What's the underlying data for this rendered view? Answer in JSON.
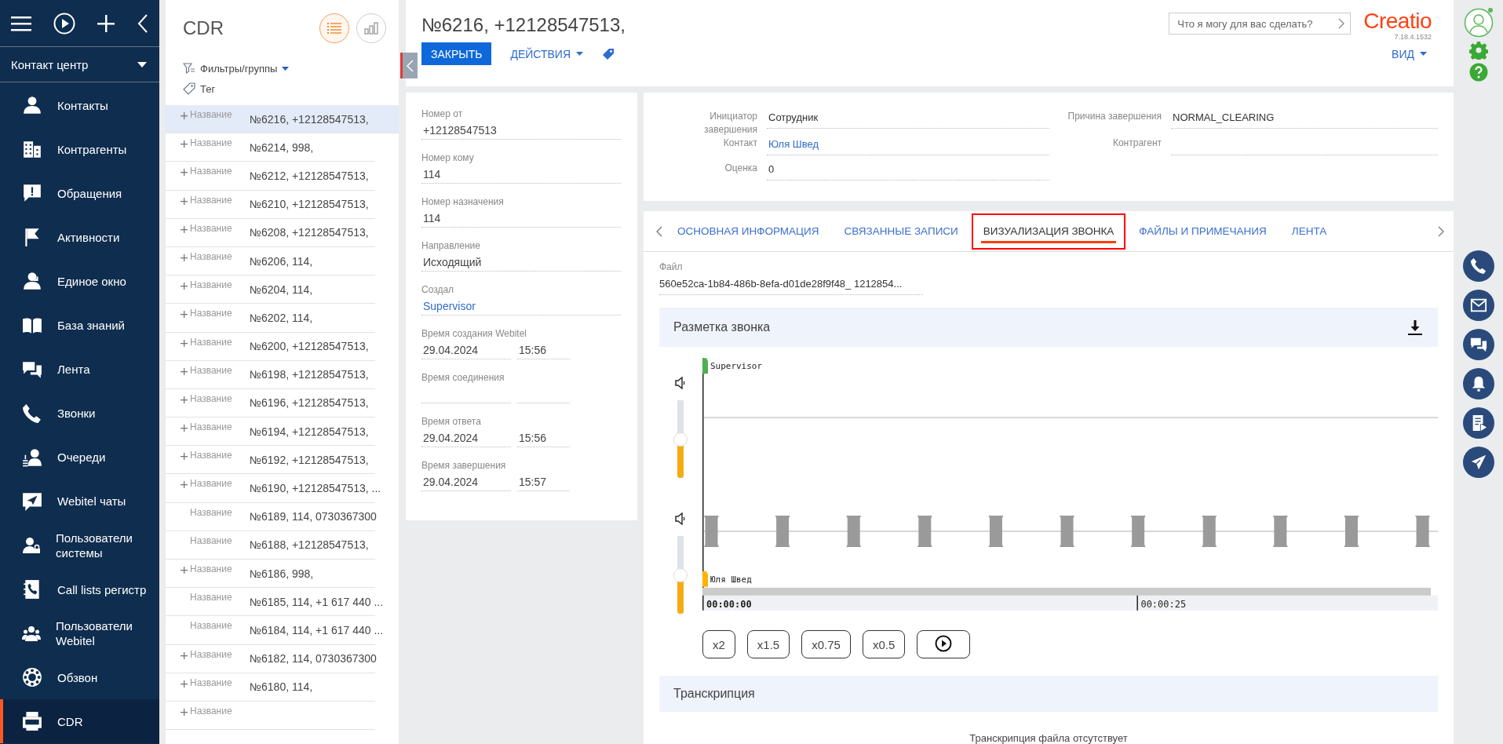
{
  "sidebar": {
    "workplace": "Контакт центр",
    "items": [
      {
        "label": "Контакты",
        "selected": false
      },
      {
        "label": "Контрагенты",
        "selected": false
      },
      {
        "label": "Обращения",
        "selected": false
      },
      {
        "label": "Активности",
        "selected": false
      },
      {
        "label": "Единое окно",
        "selected": false
      },
      {
        "label": "База знаний",
        "selected": false
      },
      {
        "label": "Лента",
        "selected": false
      },
      {
        "label": "Звонки",
        "selected": false
      },
      {
        "label": "Очереди",
        "selected": false
      },
      {
        "label": "Webitel чаты",
        "selected": false
      },
      {
        "label": "Пользователи системы",
        "selected": false
      },
      {
        "label": "Call lists регистр",
        "selected": false
      },
      {
        "label": "Пользователи Webitel",
        "selected": false
      },
      {
        "label": "Обзвон",
        "selected": false
      },
      {
        "label": "CDR",
        "selected": true
      }
    ]
  },
  "list": {
    "title": "CDR",
    "view_buttons": [
      {
        "selected": true
      },
      {
        "selected": false
      }
    ],
    "filters": "Фильтры/группы",
    "tag": "Тег",
    "rows": [
      {
        "label": "Название",
        "value": "№6216, +12128547513,",
        "plus": true,
        "selected": true
      },
      {
        "label": "Название",
        "value": "№6214, 998,",
        "plus": true,
        "selected": false
      },
      {
        "label": "Название",
        "value": "№6212, +12128547513,",
        "plus": true,
        "selected": false
      },
      {
        "label": "Название",
        "value": "№6210, +12128547513,",
        "plus": true,
        "selected": false
      },
      {
        "label": "Название",
        "value": "№6208, +12128547513,",
        "plus": true,
        "selected": false
      },
      {
        "label": "Название",
        "value": "№6206, 114,",
        "plus": true,
        "selected": false
      },
      {
        "label": "Название",
        "value": "№6204, 114,",
        "plus": true,
        "selected": false
      },
      {
        "label": "Название",
        "value": "№6202, 114,",
        "plus": true,
        "selected": false
      },
      {
        "label": "Название",
        "value": "№6200, +12128547513,",
        "plus": true,
        "selected": false
      },
      {
        "label": "Название",
        "value": "№6198, +12128547513,",
        "plus": true,
        "selected": false
      },
      {
        "label": "Название",
        "value": "№6196, +12128547513,",
        "plus": true,
        "selected": false
      },
      {
        "label": "Название",
        "value": "№6194, +12128547513,",
        "plus": true,
        "selected": false
      },
      {
        "label": "Название",
        "value": "№6192, +12128547513,",
        "plus": true,
        "selected": false
      },
      {
        "label": "Название",
        "value": "№6190, +12128547513, ...",
        "plus": true,
        "selected": false
      },
      {
        "label": "Название",
        "value": "№6189, 114, 0730367300",
        "plus": false,
        "selected": false
      },
      {
        "label": "Название",
        "value": "№6188, +12128547513,",
        "plus": false,
        "selected": false
      },
      {
        "label": "Название",
        "value": "№6186, 998,",
        "plus": true,
        "selected": false
      },
      {
        "label": "Название",
        "value": "№6185, 114, +1 617 440 ...",
        "plus": false,
        "selected": false
      },
      {
        "label": "Название",
        "value": "№6184, 114, +1 617 440 ...",
        "plus": false,
        "selected": false
      },
      {
        "label": "Название",
        "value": "№6182, 114, 0730367300",
        "plus": true,
        "selected": false
      },
      {
        "label": "Название",
        "value": "№6180, 114,",
        "plus": true,
        "selected": false
      },
      {
        "label": "Название",
        "plus": true,
        "selected": false
      }
    ]
  },
  "header": {
    "title": "№6216, +12128547513,",
    "close_button": "ЗАКРЫТЬ",
    "actions": "ДЕЙСТВИЯ",
    "search_placeholder": "Что я могу для вас сделать?",
    "logo": "Creatio",
    "version": "7.18.4.1532",
    "view": "ВИД"
  },
  "details": [
    {
      "label": "Номер от",
      "value": "+12128547513",
      "kind": "text"
    },
    {
      "label": "Номер кому",
      "value": "114",
      "kind": "text"
    },
    {
      "label": "Номер назначения",
      "value": "114",
      "kind": "text"
    },
    {
      "label": "Направление",
      "value": "Исходящий",
      "kind": "text"
    },
    {
      "label": "Создал",
      "value": "Supervisor",
      "kind": "link"
    },
    {
      "label": "Время создания Webitel",
      "date": "29.04.2024",
      "time": "15:56",
      "kind": "datetime"
    },
    {
      "label": "Время соединения",
      "kind": "datetime"
    },
    {
      "label": "Время ответа",
      "date": "29.04.2024",
      "time": "15:56",
      "kind": "datetime"
    },
    {
      "label": "Время завершения",
      "date": "29.04.2024",
      "time": "15:57",
      "kind": "datetime"
    }
  ],
  "summary": [
    {
      "label": "Инициатор завершения",
      "value": "Сотрудник",
      "kind": "text"
    },
    {
      "label": "Контакт",
      "value": "Юля Швед",
      "kind": "link"
    },
    {
      "label": "Оценка",
      "value": "0",
      "kind": "text"
    },
    {
      "label": "Причина завершения",
      "value": "NORMAL_CLEARING",
      "kind": "text"
    },
    {
      "label": "Контрагент",
      "kind": "text"
    }
  ],
  "tabs": [
    {
      "label": "ОСНОВНАЯ ИНФОРМАЦИЯ",
      "selected": false,
      "highlighted": false
    },
    {
      "label": "СВЯЗАННЫЕ ЗАПИСИ",
      "selected": false,
      "highlighted": false
    },
    {
      "label": "ВИЗУАЛИЗАЦИЯ ЗВОНКА",
      "selected": true,
      "highlighted": true
    },
    {
      "label": "ФАЙЛЫ И ПРИМЕЧАНИЯ",
      "selected": false,
      "highlighted": false
    },
    {
      "label": "ЛЕНТА",
      "selected": false,
      "highlighted": false
    }
  ],
  "visualization": {
    "file_label": "Файл",
    "file_value": "560e52ca-1b84-486b-8efa-d01de28f9f48_ 1212854...",
    "section_title": "Разметка звонка",
    "tracks": [
      {
        "name": "Supervisor",
        "color": "#4caf50",
        "level": 0.5
      },
      {
        "name": "Юля Швед",
        "color": "#ffb300",
        "level": 0.5
      }
    ],
    "time_marks": [
      "00:00:00",
      "00:00:25"
    ],
    "speed_buttons": [
      "x2",
      "x1.5",
      "x0.75",
      "x0.5"
    ],
    "transcript_title": "Транскрипция",
    "transcript_empty": "Транскрипция файла отсутствует"
  }
}
